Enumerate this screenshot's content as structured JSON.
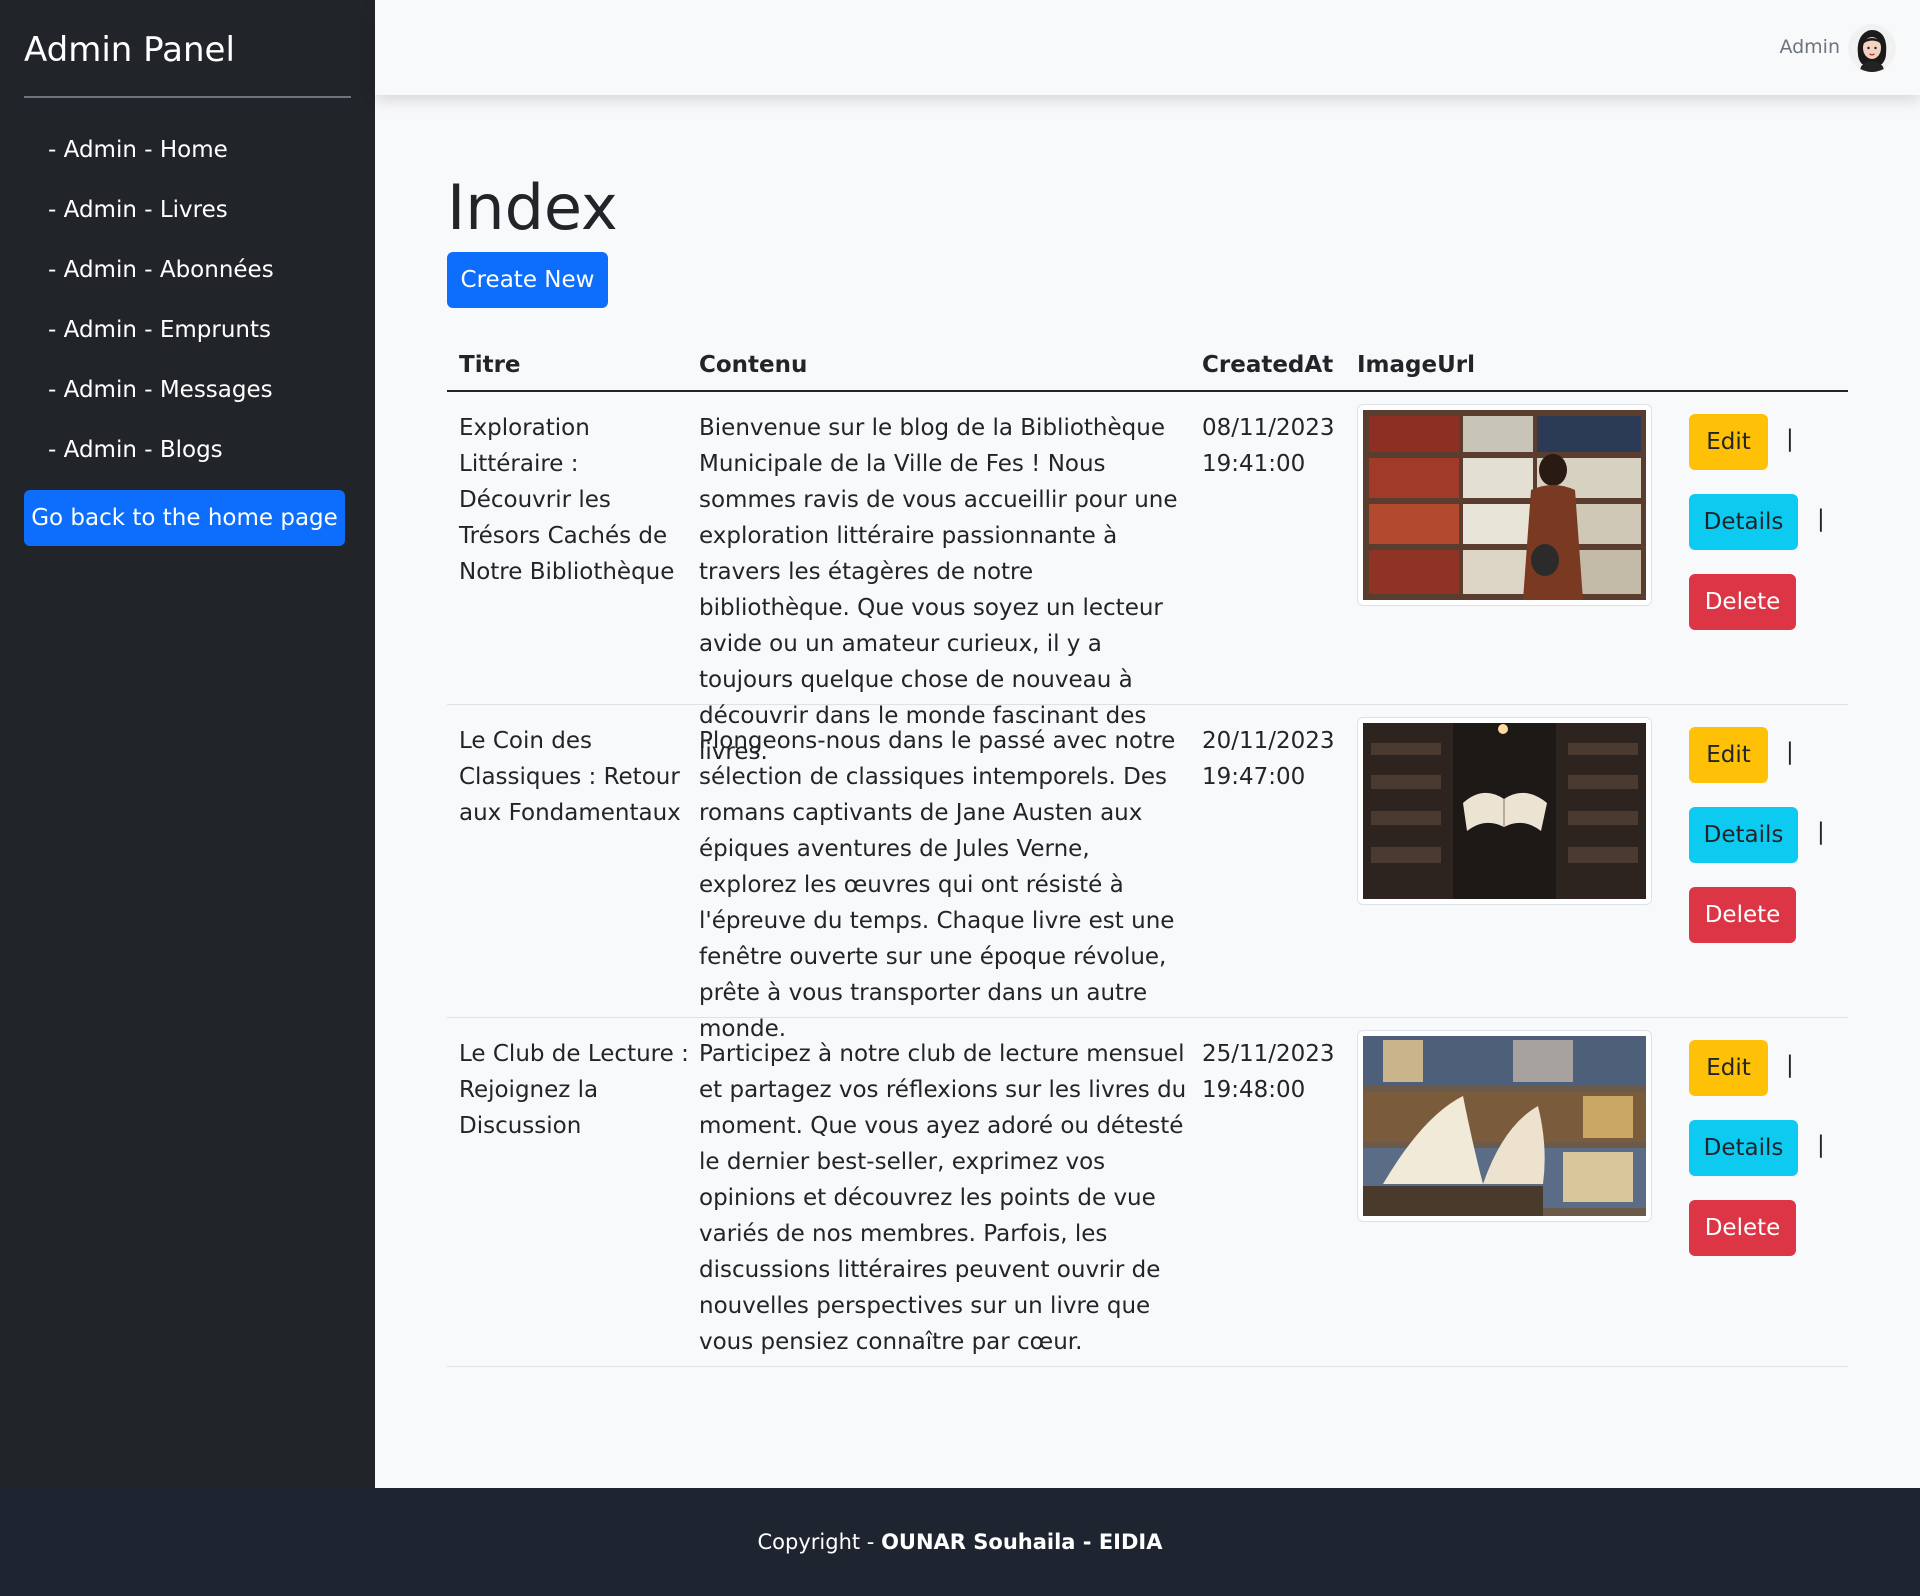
{
  "sidebar": {
    "title": "Admin Panel",
    "items": [
      {
        "label": "- Admin - Home"
      },
      {
        "label": "- Admin - Livres"
      },
      {
        "label": "- Admin - Abonnées"
      },
      {
        "label": "- Admin - Emprunts"
      },
      {
        "label": "- Admin - Messages"
      },
      {
        "label": "- Admin - Blogs"
      }
    ],
    "home_button": "Go back to the home page"
  },
  "topbar": {
    "user": "Admin",
    "avatar_icon": "user-avatar"
  },
  "main": {
    "title": "Index",
    "create_button": "Create New",
    "columns": [
      "Titre",
      "Contenu",
      "CreatedAt",
      "ImageUrl"
    ],
    "rows": [
      {
        "titre": "Exploration Littéraire : Découvrir les Trésors Cachés de Notre Bibliothèque",
        "contenu": "Bienvenue sur le blog de la Bibliothèque Municipale de la Ville de Fes ! Nous sommes ravis de vous accueillir pour une exploration littéraire passionnante à travers les étagères de notre bibliothèque. Que vous soyez un lecteur avide ou un amateur curieux, il y a toujours quelque chose de nouveau à découvrir dans le monde fascinant des livres.",
        "date": "08/11/2023",
        "time": "19:41:00"
      },
      {
        "titre": "Le Coin des Classiques : Retour aux Fondamentaux",
        "contenu": "Plongeons-nous dans le passé avec notre sélection de classiques intemporels. Des romans captivants de Jane Austen aux épiques aventures de Jules Verne, explorez les œuvres qui ont résisté à l'épreuve du temps. Chaque livre est une fenêtre ouverte sur une époque révolue, prête à vous transporter dans un autre monde.",
        "date": "20/11/2023",
        "time": "19:47:00"
      },
      {
        "titre": "Le Club de Lecture : Rejoignez la Discussion",
        "contenu": "Participez à notre club de lecture mensuel et partagez vos réflexions sur les livres du moment. Que vous ayez adoré ou détesté le dernier best-seller, exprimez vos opinions et découvrez les points de vue variés de nos membres. Parfois, les discussions littéraires peuvent ouvrir de nouvelles perspectives sur un livre que vous pensiez connaître par cœur.",
        "date": "25/11/2023",
        "time": "19:48:00"
      }
    ],
    "actions": {
      "edit": "Edit",
      "details": "Details",
      "delete": "Delete",
      "separator": "|"
    }
  },
  "footer": {
    "prefix": "Copyright - ",
    "author": "OUNAR Souhaila",
    "mid": " - ",
    "org": "EIDIA"
  },
  "colors": {
    "sidebar": "#212529",
    "primary": "#0d6efd",
    "warning": "#ffc107",
    "info": "#0dcaf0",
    "danger": "#dc3545",
    "footer": "#1e2530"
  }
}
